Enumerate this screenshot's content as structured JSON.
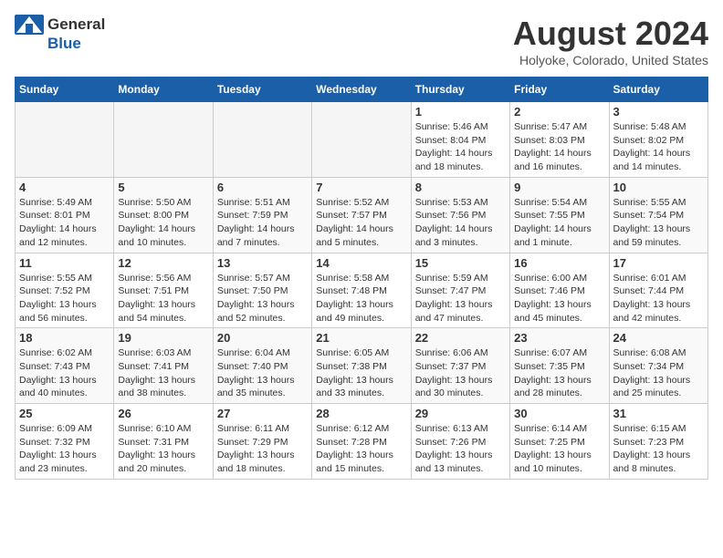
{
  "header": {
    "logo_general": "General",
    "logo_blue": "Blue",
    "month_title": "August 2024",
    "location": "Holyoke, Colorado, United States"
  },
  "days_of_week": [
    "Sunday",
    "Monday",
    "Tuesday",
    "Wednesday",
    "Thursday",
    "Friday",
    "Saturday"
  ],
  "weeks": [
    [
      {
        "day": "",
        "empty": true
      },
      {
        "day": "",
        "empty": true
      },
      {
        "day": "",
        "empty": true
      },
      {
        "day": "",
        "empty": true
      },
      {
        "day": "1",
        "sunrise": "Sunrise: 5:46 AM",
        "sunset": "Sunset: 8:04 PM",
        "daylight": "Daylight: 14 hours and 18 minutes."
      },
      {
        "day": "2",
        "sunrise": "Sunrise: 5:47 AM",
        "sunset": "Sunset: 8:03 PM",
        "daylight": "Daylight: 14 hours and 16 minutes."
      },
      {
        "day": "3",
        "sunrise": "Sunrise: 5:48 AM",
        "sunset": "Sunset: 8:02 PM",
        "daylight": "Daylight: 14 hours and 14 minutes."
      }
    ],
    [
      {
        "day": "4",
        "sunrise": "Sunrise: 5:49 AM",
        "sunset": "Sunset: 8:01 PM",
        "daylight": "Daylight: 14 hours and 12 minutes."
      },
      {
        "day": "5",
        "sunrise": "Sunrise: 5:50 AM",
        "sunset": "Sunset: 8:00 PM",
        "daylight": "Daylight: 14 hours and 10 minutes."
      },
      {
        "day": "6",
        "sunrise": "Sunrise: 5:51 AM",
        "sunset": "Sunset: 7:59 PM",
        "daylight": "Daylight: 14 hours and 7 minutes."
      },
      {
        "day": "7",
        "sunrise": "Sunrise: 5:52 AM",
        "sunset": "Sunset: 7:57 PM",
        "daylight": "Daylight: 14 hours and 5 minutes."
      },
      {
        "day": "8",
        "sunrise": "Sunrise: 5:53 AM",
        "sunset": "Sunset: 7:56 PM",
        "daylight": "Daylight: 14 hours and 3 minutes."
      },
      {
        "day": "9",
        "sunrise": "Sunrise: 5:54 AM",
        "sunset": "Sunset: 7:55 PM",
        "daylight": "Daylight: 14 hours and 1 minute."
      },
      {
        "day": "10",
        "sunrise": "Sunrise: 5:55 AM",
        "sunset": "Sunset: 7:54 PM",
        "daylight": "Daylight: 13 hours and 59 minutes."
      }
    ],
    [
      {
        "day": "11",
        "sunrise": "Sunrise: 5:55 AM",
        "sunset": "Sunset: 7:52 PM",
        "daylight": "Daylight: 13 hours and 56 minutes."
      },
      {
        "day": "12",
        "sunrise": "Sunrise: 5:56 AM",
        "sunset": "Sunset: 7:51 PM",
        "daylight": "Daylight: 13 hours and 54 minutes."
      },
      {
        "day": "13",
        "sunrise": "Sunrise: 5:57 AM",
        "sunset": "Sunset: 7:50 PM",
        "daylight": "Daylight: 13 hours and 52 minutes."
      },
      {
        "day": "14",
        "sunrise": "Sunrise: 5:58 AM",
        "sunset": "Sunset: 7:48 PM",
        "daylight": "Daylight: 13 hours and 49 minutes."
      },
      {
        "day": "15",
        "sunrise": "Sunrise: 5:59 AM",
        "sunset": "Sunset: 7:47 PM",
        "daylight": "Daylight: 13 hours and 47 minutes."
      },
      {
        "day": "16",
        "sunrise": "Sunrise: 6:00 AM",
        "sunset": "Sunset: 7:46 PM",
        "daylight": "Daylight: 13 hours and 45 minutes."
      },
      {
        "day": "17",
        "sunrise": "Sunrise: 6:01 AM",
        "sunset": "Sunset: 7:44 PM",
        "daylight": "Daylight: 13 hours and 42 minutes."
      }
    ],
    [
      {
        "day": "18",
        "sunrise": "Sunrise: 6:02 AM",
        "sunset": "Sunset: 7:43 PM",
        "daylight": "Daylight: 13 hours and 40 minutes."
      },
      {
        "day": "19",
        "sunrise": "Sunrise: 6:03 AM",
        "sunset": "Sunset: 7:41 PM",
        "daylight": "Daylight: 13 hours and 38 minutes."
      },
      {
        "day": "20",
        "sunrise": "Sunrise: 6:04 AM",
        "sunset": "Sunset: 7:40 PM",
        "daylight": "Daylight: 13 hours and 35 minutes."
      },
      {
        "day": "21",
        "sunrise": "Sunrise: 6:05 AM",
        "sunset": "Sunset: 7:38 PM",
        "daylight": "Daylight: 13 hours and 33 minutes."
      },
      {
        "day": "22",
        "sunrise": "Sunrise: 6:06 AM",
        "sunset": "Sunset: 7:37 PM",
        "daylight": "Daylight: 13 hours and 30 minutes."
      },
      {
        "day": "23",
        "sunrise": "Sunrise: 6:07 AM",
        "sunset": "Sunset: 7:35 PM",
        "daylight": "Daylight: 13 hours and 28 minutes."
      },
      {
        "day": "24",
        "sunrise": "Sunrise: 6:08 AM",
        "sunset": "Sunset: 7:34 PM",
        "daylight": "Daylight: 13 hours and 25 minutes."
      }
    ],
    [
      {
        "day": "25",
        "sunrise": "Sunrise: 6:09 AM",
        "sunset": "Sunset: 7:32 PM",
        "daylight": "Daylight: 13 hours and 23 minutes."
      },
      {
        "day": "26",
        "sunrise": "Sunrise: 6:10 AM",
        "sunset": "Sunset: 7:31 PM",
        "daylight": "Daylight: 13 hours and 20 minutes."
      },
      {
        "day": "27",
        "sunrise": "Sunrise: 6:11 AM",
        "sunset": "Sunset: 7:29 PM",
        "daylight": "Daylight: 13 hours and 18 minutes."
      },
      {
        "day": "28",
        "sunrise": "Sunrise: 6:12 AM",
        "sunset": "Sunset: 7:28 PM",
        "daylight": "Daylight: 13 hours and 15 minutes."
      },
      {
        "day": "29",
        "sunrise": "Sunrise: 6:13 AM",
        "sunset": "Sunset: 7:26 PM",
        "daylight": "Daylight: 13 hours and 13 minutes."
      },
      {
        "day": "30",
        "sunrise": "Sunrise: 6:14 AM",
        "sunset": "Sunset: 7:25 PM",
        "daylight": "Daylight: 13 hours and 10 minutes."
      },
      {
        "day": "31",
        "sunrise": "Sunrise: 6:15 AM",
        "sunset": "Sunset: 7:23 PM",
        "daylight": "Daylight: 13 hours and 8 minutes."
      }
    ]
  ]
}
